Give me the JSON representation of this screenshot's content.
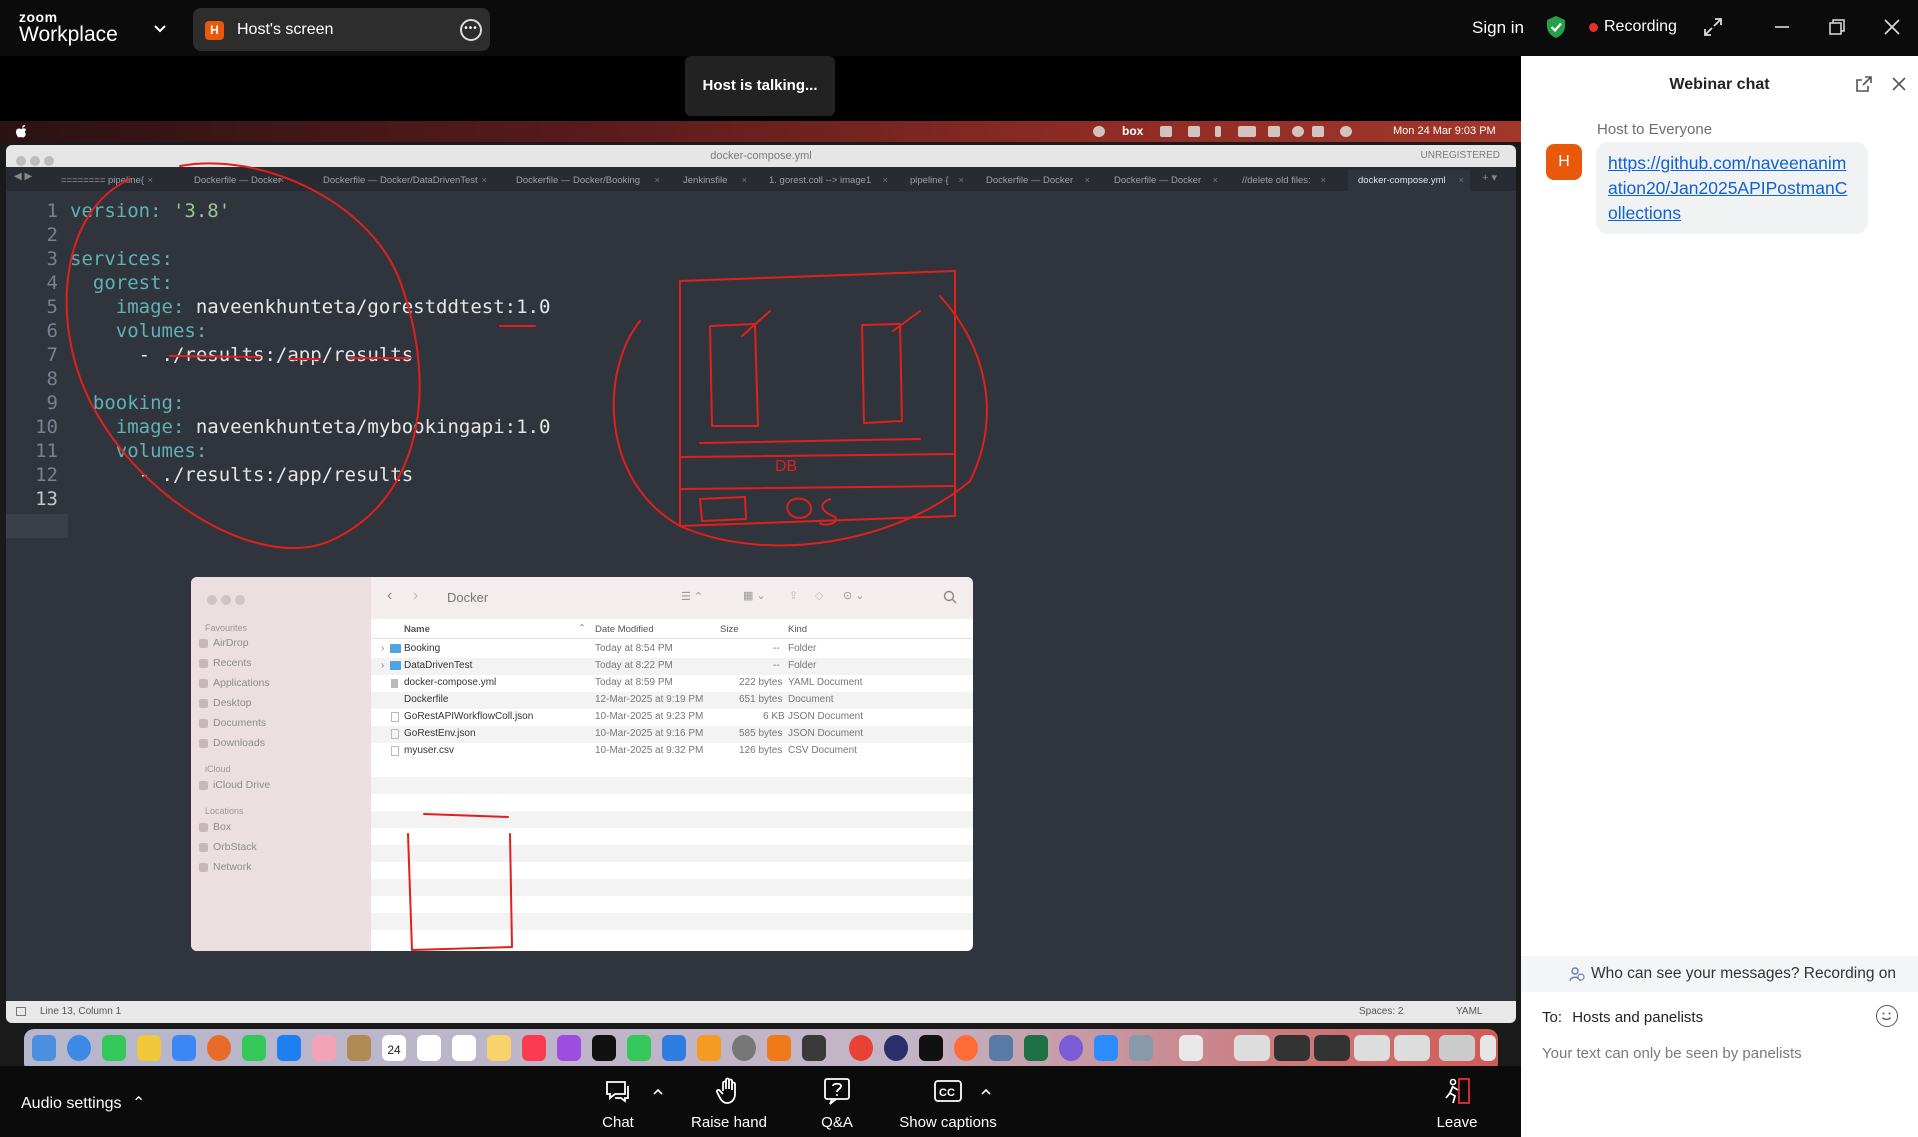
{
  "app": {
    "brand_top": "zoom",
    "brand_bottom": "Workplace",
    "share_label": "Host's screen",
    "share_initial": "H",
    "signin_label": "Sign in",
    "recording_label": "Recording",
    "talking_label": "Host is talking...",
    "icons": [
      "chevron-down-icon",
      "more-options-icon",
      "shield-check-icon",
      "expand-icon",
      "minimize-icon",
      "restore-icon",
      "close-icon"
    ]
  },
  "shared": {
    "menubar_clock": "Mon 24 Mar  9:03 PM",
    "menubar_box": "box",
    "editor": {
      "window_title": "docker-compose.yml",
      "unregistered": "UNREGISTERED",
      "tabs": [
        {
          "label": "======== pipeline{"
        },
        {
          "label": "Dockerfile — Docker"
        },
        {
          "label": "Dockerfile — Docker/DataDrivenTest"
        },
        {
          "label": "Dockerfile — Docker/Booking"
        },
        {
          "label": "Jenkinsfile"
        },
        {
          "label": "1. gorest.coll --> image1"
        },
        {
          "label": "pipeline {"
        },
        {
          "label": "Dockerfile — Docker"
        },
        {
          "label": "Dockerfile — Docker"
        },
        {
          "label": "//delete old files:"
        },
        {
          "label": "docker-compose.yml"
        }
      ],
      "line_numbers": [
        "1",
        "2",
        "3",
        "4",
        "5",
        "6",
        "7",
        "8",
        "9",
        "10",
        "11",
        "12",
        "13"
      ],
      "code": {
        "l1_key": "version:",
        "l1_val": " '3.8'",
        "l3_key": "services:",
        "l4_key": "  gorest:",
        "l5_key": "    image:",
        "l5_val": " naveenkhunteta/gorestddtest:1.0",
        "l6_key": "    volumes:",
        "l7_val": "      - ./results:/app/results",
        "l9_key": "  booking:",
        "l10_key": "    image:",
        "l10_val": " naveenkhunteta/mybookingapi:1.0",
        "l11_key": "    volumes:",
        "l12_val": "      - ./results:/app/results"
      },
      "status_left": "Line 13, Column 1",
      "status_spaces": "Spaces: 2",
      "status_syntax": "YAML"
    },
    "finder": {
      "title": "Docker",
      "sidebar": {
        "favourites_heading": "Favourites",
        "favourites": [
          "AirDrop",
          "Recents",
          "Applications",
          "Desktop",
          "Documents",
          "Downloads"
        ],
        "icloud_heading": "iCloud",
        "icloud": [
          "iCloud Drive"
        ],
        "locations_heading": "Locations",
        "locations": [
          "Box",
          "OrbStack",
          "Network"
        ]
      },
      "columns": {
        "name": "Name",
        "date": "Date Modified",
        "size": "Size",
        "kind": "Kind"
      },
      "rows": [
        {
          "name": "Booking",
          "date": "Today at 8:54 PM",
          "size": "--",
          "kind": "Folder"
        },
        {
          "name": "DataDrivenTest",
          "date": "Today at 8:22 PM",
          "size": "--",
          "kind": "Folder"
        },
        {
          "name": "docker-compose.yml",
          "date": "Today at 8:59 PM",
          "size": "222 bytes",
          "kind": "YAML Document"
        },
        {
          "name": "Dockerfile",
          "date": "12-Mar-2025 at 9:19 PM",
          "size": "651 bytes",
          "kind": "Document"
        },
        {
          "name": "GoRestAPIWorkflowColl.json",
          "date": "10-Mar-2025 at 9:23 PM",
          "size": "6 KB",
          "kind": "JSON Document"
        },
        {
          "name": "GoRestEnv.json",
          "date": "10-Mar-2025 at 9:16 PM",
          "size": "585 bytes",
          "kind": "JSON Document"
        },
        {
          "name": "myuser.csv",
          "date": "10-Mar-2025 at 9:32 PM",
          "size": "126 bytes",
          "kind": "CSV Document"
        }
      ]
    },
    "annotation_text": "DB",
    "annotation_color": "#e0211b",
    "dock_date": "24"
  },
  "bottom": {
    "audio_label": "Audio settings",
    "chat_label": "Chat",
    "raise_hand_label": "Raise hand",
    "qa_label": "Q&A",
    "captions_label": "Show captions",
    "leave_label": "Leave"
  },
  "chat": {
    "title": "Webinar chat",
    "from": "Host to Everyone",
    "avatar_initial": "H",
    "message_link": "https://github.com/naveenanimation20/Jan2025APIPostmanCollections",
    "who_can_see": "Who can see your messages? Recording on",
    "to_prefix": "To:",
    "to_value": "Hosts and panelists",
    "input_placeholder": "Your text can only be seen by panelists"
  },
  "colors": {
    "accent_orange": "#e8590c",
    "recording_red": "#e3302f",
    "link_blue": "#0e62d6",
    "shield_green": "#24a148"
  }
}
